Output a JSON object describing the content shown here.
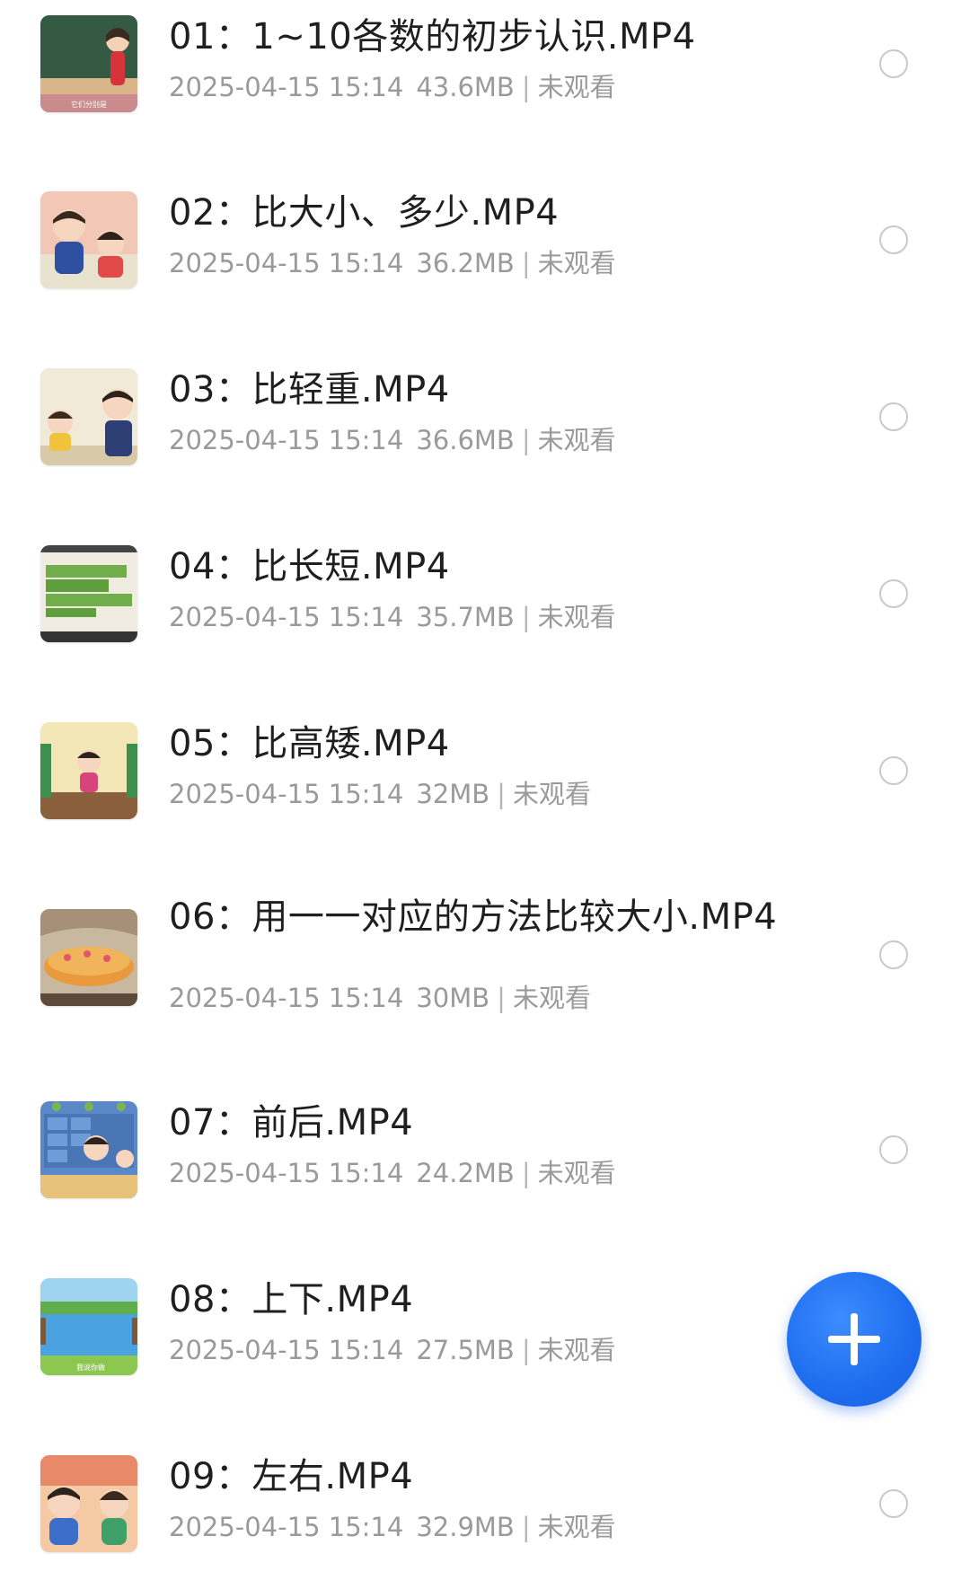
{
  "videos": [
    {
      "title": "01：1~10各数的初步认识.MP4",
      "date": "2025-04-15 15:14",
      "size": "43.6MB",
      "status": "未观看",
      "thumb_caption": "它们分别是"
    },
    {
      "title": "02：比大小、多少.MP4",
      "date": "2025-04-15 15:14",
      "size": "36.2MB",
      "status": "未观看",
      "thumb_caption": ""
    },
    {
      "title": "03：比轻重.MP4",
      "date": "2025-04-15 15:14",
      "size": "36.6MB",
      "status": "未观看",
      "thumb_caption": ""
    },
    {
      "title": "04：比长短.MP4",
      "date": "2025-04-15 15:14",
      "size": "35.7MB",
      "status": "未观看",
      "thumb_caption": ""
    },
    {
      "title": "05：比高矮.MP4",
      "date": "2025-04-15 15:14",
      "size": "32MB",
      "status": "未观看",
      "thumb_caption": ""
    },
    {
      "title": "06：用一一对应的方法比较大小.MP4",
      "date": "2025-04-15 15:14",
      "size": "30MB",
      "status": "未观看",
      "thumb_caption": ""
    },
    {
      "title": "07：前后.MP4",
      "date": "2025-04-15 15:14",
      "size": "24.2MB",
      "status": "未观看",
      "thumb_caption": ""
    },
    {
      "title": "08：上下.MP4",
      "date": "2025-04-15 15:14",
      "size": "27.5MB",
      "status": "未观看",
      "thumb_caption": "我说你做"
    },
    {
      "title": "09：左右.MP4",
      "date": "2025-04-15 15:14",
      "size": "32.9MB",
      "status": "未观看",
      "thumb_caption": ""
    }
  ],
  "separator": "|",
  "fab": {
    "icon": "plus-icon"
  },
  "colors": {
    "fab": "#1f6ff0",
    "title": "#1f1f1f",
    "meta": "#9a9a9a",
    "radio_border": "#c9c9c9"
  }
}
